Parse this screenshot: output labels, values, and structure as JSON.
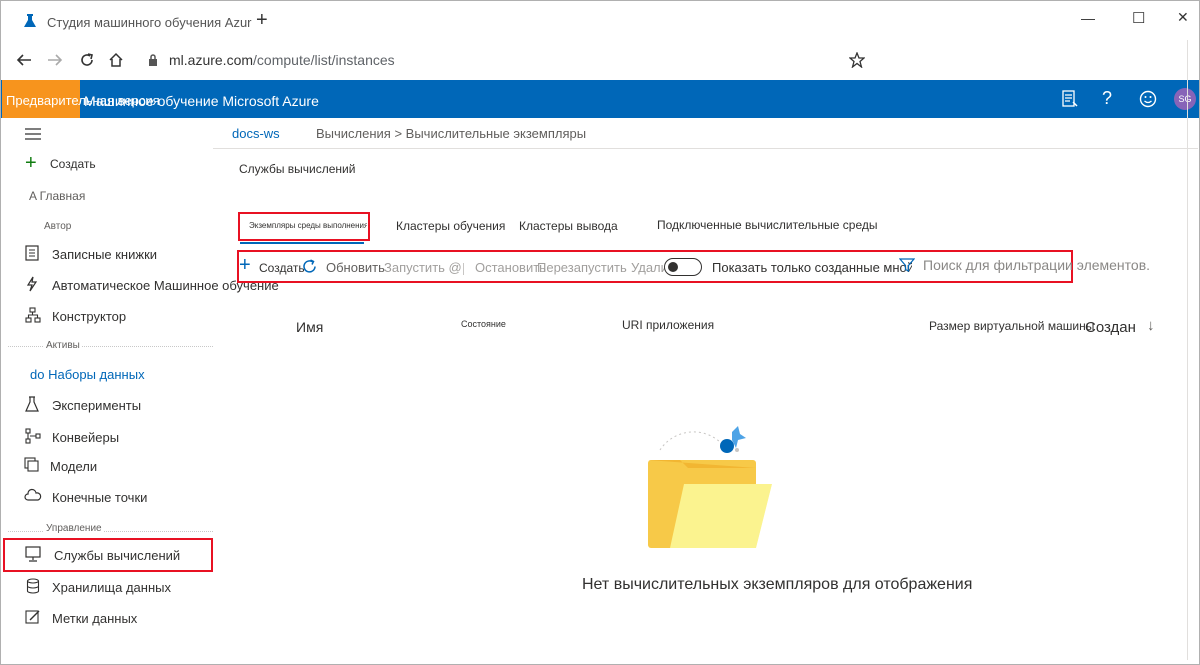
{
  "browser": {
    "tab_title": "Студия машинного обучения Azure (I",
    "new_tab": "+",
    "url_host": "ml.azure.com",
    "url_path": "/compute/list/instances",
    "window_controls": [
      "—",
      "☐",
      "✕"
    ]
  },
  "header": {
    "preview_label": "Предварительная версия",
    "product_title": "Машинное обучение Microsoft Azure",
    "avatar_initials": "SG"
  },
  "sidebar": {
    "create_label": "Создать",
    "home_label": "A Главная",
    "author_section": "Автор",
    "items_author": [
      "Записные книжки",
      "Автоматическое Машинное обучение",
      "Конструктор"
    ],
    "assets_section": "Активы",
    "datasets_label": "do Наборы данных",
    "items_assets": [
      "Эксперименты",
      "Конвейеры",
      "Модели",
      "Конечные точки"
    ],
    "manage_section": "Управление",
    "items_manage": [
      "Службы вычислений",
      "Хранилища данных",
      "Метки данных"
    ]
  },
  "breadcrumb": {
    "workspace": "docs-ws",
    "path": "Вычисления > Вычислительные экземпляры"
  },
  "page_title": "Службы вычислений",
  "tabs": [
    "Экземпляры среды выполнения приложений",
    "Кластеры обучения",
    "Кластеры вывода",
    "Подключенные вычислительные среды"
  ],
  "toolbar": {
    "create": "Создать",
    "refresh": "Обновить",
    "start": "Запустить @",
    "stop": "Остановить",
    "restart": "Перезапустить",
    "delete": "Удалить",
    "toggle_label": "Показать только созданные мной",
    "search_placeholder": "Поиск для фильтрации элементов."
  },
  "table": {
    "columns": [
      "Имя",
      "Состояние",
      "URI приложения",
      "Размер виртуальной машины",
      "Создан"
    ],
    "sort_indicator": "↓"
  },
  "empty_state": {
    "message": "Нет вычислительных экземпляров для отображения"
  },
  "colors": {
    "azure_blue": "#0067b8",
    "preview_orange": "#f7941d",
    "highlight_red": "#e81123",
    "folder_yellow": "#f7c948"
  }
}
